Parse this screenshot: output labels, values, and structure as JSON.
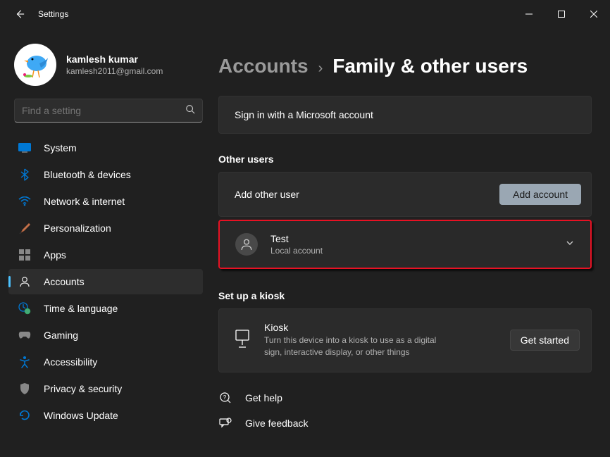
{
  "window": {
    "title": "Settings"
  },
  "profile": {
    "name": "kamlesh kumar",
    "email": "kamlesh2011@gmail.com"
  },
  "search": {
    "placeholder": "Find a setting"
  },
  "nav": [
    {
      "label": "System"
    },
    {
      "label": "Bluetooth & devices"
    },
    {
      "label": "Network & internet"
    },
    {
      "label": "Personalization"
    },
    {
      "label": "Apps"
    },
    {
      "label": "Accounts"
    },
    {
      "label": "Time & language"
    },
    {
      "label": "Gaming"
    },
    {
      "label": "Accessibility"
    },
    {
      "label": "Privacy & security"
    },
    {
      "label": "Windows Update"
    }
  ],
  "breadcrumb": {
    "parent": "Accounts",
    "current": "Family & other users"
  },
  "signin_card": {
    "text": "Sign in with a Microsoft account"
  },
  "other_users": {
    "title": "Other users",
    "add_label": "Add other user",
    "add_button": "Add account",
    "user": {
      "name": "Test",
      "sub": "Local account"
    }
  },
  "kiosk": {
    "section_title": "Set up a kiosk",
    "title": "Kiosk",
    "desc": "Turn this device into a kiosk to use as a digital sign, interactive display, or other things",
    "button": "Get started"
  },
  "footer": {
    "help": "Get help",
    "feedback": "Give feedback"
  }
}
